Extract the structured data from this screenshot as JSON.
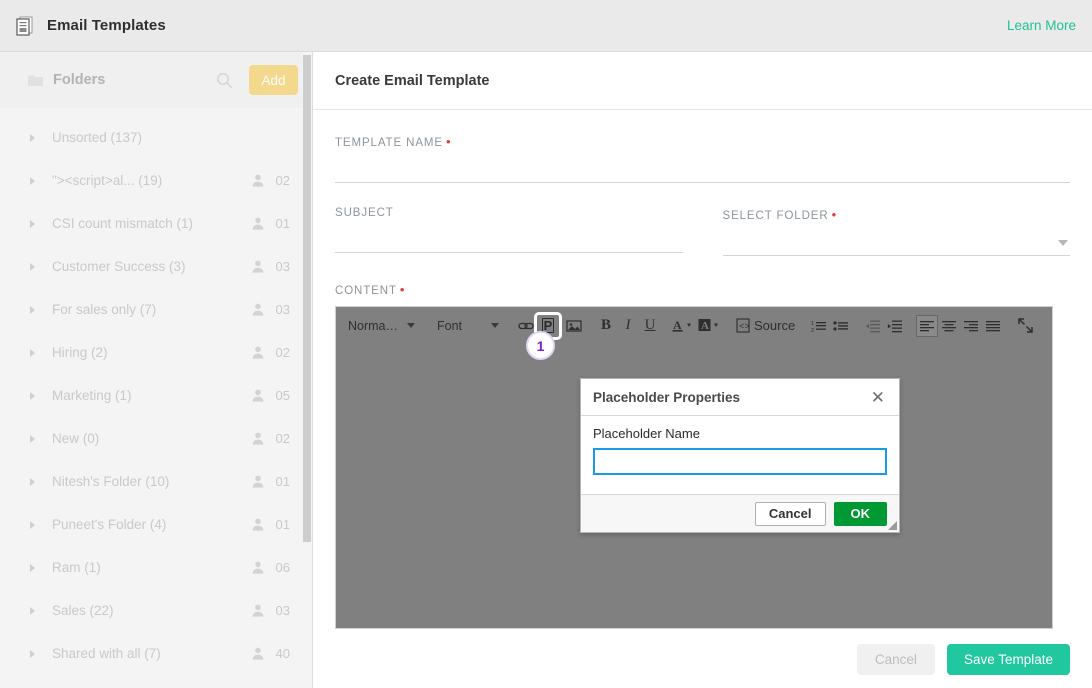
{
  "header": {
    "icon": "document-icon",
    "title": "Email Templates",
    "learn_more": "Learn More",
    "accent_color": "#21c198"
  },
  "sidebar": {
    "icon": "folder-icon",
    "title": "Folders",
    "search_icon": "search-icon",
    "add_label": "Add",
    "add_color": "#f2d98d",
    "folders": [
      {
        "name": "Unsorted (137)",
        "shared": ""
      },
      {
        "name": "\"><script>al... (19)",
        "shared": "02"
      },
      {
        "name": "CSI count mismatch (1)",
        "shared": "01"
      },
      {
        "name": "Customer Success (3)",
        "shared": "03"
      },
      {
        "name": "For sales only (7)",
        "shared": "03"
      },
      {
        "name": "Hiring (2)",
        "shared": "02"
      },
      {
        "name": "Marketing (1)",
        "shared": "05"
      },
      {
        "name": "New (0)",
        "shared": "02"
      },
      {
        "name": "Nitesh's Folder (10)",
        "shared": "01"
      },
      {
        "name": "Puneet's Folder (4)",
        "shared": "01"
      },
      {
        "name": "Ram (1)",
        "shared": "06"
      },
      {
        "name": "Sales (22)",
        "shared": "03"
      },
      {
        "name": "Shared with all (7)",
        "shared": "40"
      }
    ]
  },
  "main": {
    "title": "Create Email Template",
    "fields": {
      "template_name_label": "TEMPLATE NAME",
      "template_name_value": "",
      "template_name_required": true,
      "subject_label": "SUBJECT",
      "subject_value": "",
      "select_folder_label": "SELECT FOLDER",
      "select_folder_value": "",
      "select_folder_required": true,
      "content_label": "CONTENT",
      "content_required": true
    },
    "editor": {
      "paragraph_format": "Norma…",
      "font_format": "Font",
      "buttons": [
        {
          "name": "link-icon",
          "glyph": "⚭",
          "state": "normal"
        },
        {
          "name": "placeholder-icon",
          "glyph": "P",
          "state": "highlighted"
        },
        {
          "name": "image-icon",
          "glyph": "Ὓc",
          "state": "normal"
        },
        {
          "name": "bold-icon",
          "glyph": "B",
          "state": "normal"
        },
        {
          "name": "italic-icon",
          "glyph": "I",
          "state": "normal"
        },
        {
          "name": "underline-icon",
          "glyph": "U",
          "state": "normal"
        },
        {
          "name": "text-color-icon",
          "glyph": "A",
          "state": "normal"
        },
        {
          "name": "background-color-icon",
          "glyph": "A",
          "state": "normal"
        },
        {
          "name": "source-icon",
          "glyph": "Source",
          "state": "normal"
        },
        {
          "name": "numbered-list-icon",
          "glyph": "",
          "state": "normal"
        },
        {
          "name": "bulleted-list-icon",
          "glyph": "",
          "state": "normal"
        },
        {
          "name": "outdent-icon",
          "glyph": "",
          "state": "disabled"
        },
        {
          "name": "indent-icon",
          "glyph": "",
          "state": "normal"
        },
        {
          "name": "align-left-icon",
          "glyph": "",
          "state": "active"
        },
        {
          "name": "align-center-icon",
          "glyph": "",
          "state": "normal"
        },
        {
          "name": "align-right-icon",
          "glyph": "",
          "state": "normal"
        },
        {
          "name": "align-justify-icon",
          "glyph": "",
          "state": "normal"
        },
        {
          "name": "maximize-icon",
          "glyph": "",
          "state": "normal"
        }
      ],
      "source_label": "Source"
    },
    "footer": {
      "cancel_label": "Cancel",
      "save_label": "Save Template",
      "save_color": "#21c79e"
    }
  },
  "step_badge": {
    "number": "1",
    "color": "#7a1fce"
  },
  "dialog": {
    "title": "Placeholder Properties",
    "close_icon": "close-icon",
    "field_label": "Placeholder Name",
    "field_value": "",
    "cancel_label": "Cancel",
    "ok_label": "OK",
    "ok_color": "#009933",
    "focus_color": "#1a9bea"
  }
}
